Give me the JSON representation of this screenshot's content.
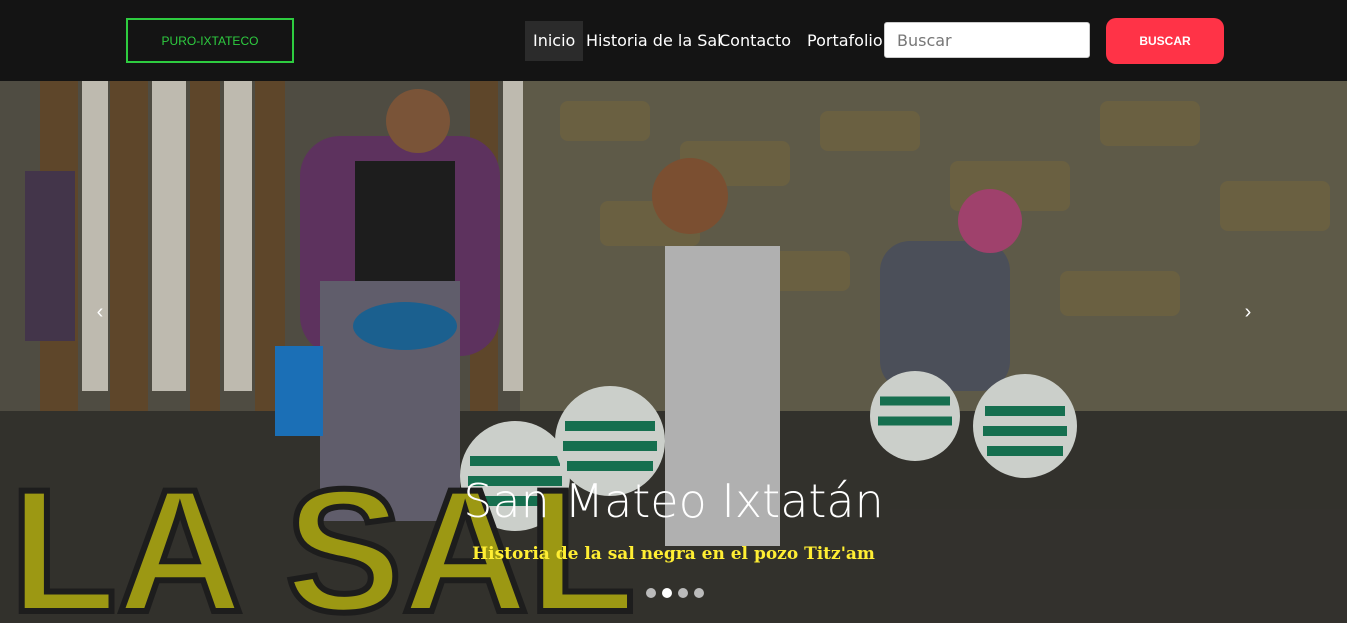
{
  "brand": "PURO-IXTATECO",
  "nav": [
    {
      "label": "Inicio",
      "active": true
    },
    {
      "label": "Historia de la Sal",
      "active": false
    },
    {
      "label": "Contacto",
      "active": false
    },
    {
      "label": "Portafolio",
      "active": false
    }
  ],
  "search": {
    "placeholder": "Buscar",
    "button": "BUSCAR"
  },
  "hero": {
    "title": "San Mateo Ixtatán",
    "subtitle": "Historia de la sal negra en el pozo Titz'am",
    "image_text": "LA SAL"
  },
  "carousel": {
    "slides": 4,
    "active": 1,
    "prev_icon": "chevron-left-icon",
    "next_icon": "chevron-right-icon"
  }
}
